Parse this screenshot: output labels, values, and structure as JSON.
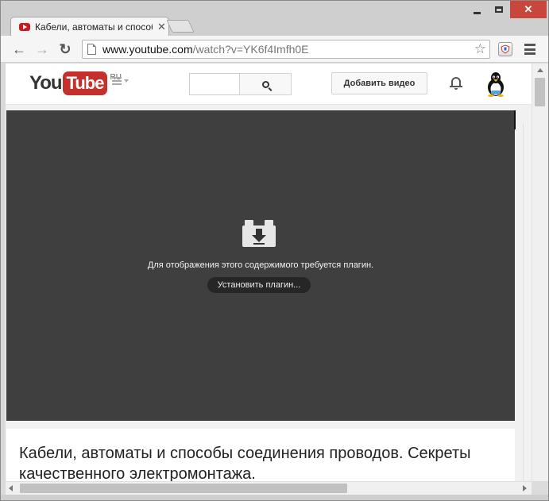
{
  "window": {
    "minimize_icon": "minimize-icon",
    "maximize_icon": "maximize-icon",
    "close_glyph": "✕"
  },
  "tab": {
    "title": "Кабели, автоматы и способы соединения проводов",
    "close_glyph": "✕"
  },
  "toolbar": {
    "back_glyph": "←",
    "forward_glyph": "→",
    "reload_glyph": "↻",
    "url_host": "www.youtube.com",
    "url_path": "/watch?v=YK6f4Imfh0E",
    "star_glyph": "☆"
  },
  "youtube": {
    "logo_you": "You",
    "logo_tube": "Tube",
    "logo_region": "RU",
    "search_placeholder": "",
    "upload_label": "Добавить видео"
  },
  "player": {
    "plugin_message": "Для отображения этого содержимого требуется плагин.",
    "install_button": "Установить плагин..."
  },
  "video": {
    "title": "Кабели, автоматы и способы соединения проводов. Секреты качественного электромонтажа."
  },
  "colors": {
    "youtube_red": "#c4302b",
    "player_bg": "#3f3f3f",
    "close_btn": "#c9463d"
  }
}
